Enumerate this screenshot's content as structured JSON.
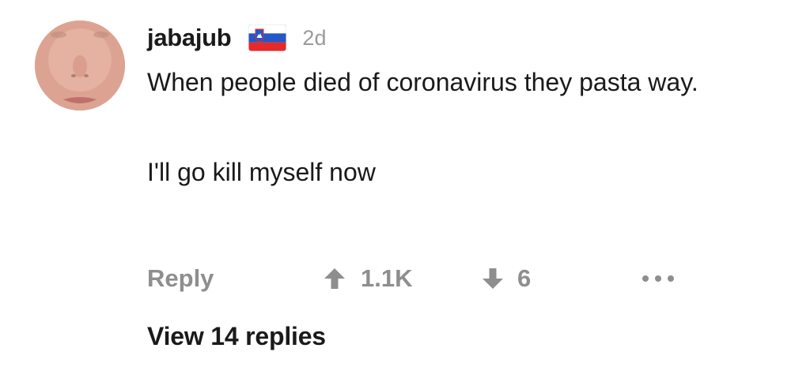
{
  "comment": {
    "author": "jabajub",
    "flag_icon": "slovenia-flag-icon",
    "age": "2d",
    "text_paragraph_1": "When people died of coronavirus they pasta way.",
    "text_paragraph_2": "I'll go kill myself now",
    "actions": {
      "reply_label": "Reply",
      "upvote_icon": "arrow-up-icon",
      "upvote_count": "1.1K",
      "downvote_icon": "arrow-down-icon",
      "downvote_count": "6",
      "more_icon": "more-options-icon"
    },
    "view_replies_label": "View 14 replies"
  },
  "colors": {
    "primary_text": "#1a1a1a",
    "muted_text": "#8e8e8e",
    "timestamp": "#9a9a9a",
    "background": "#ffffff"
  }
}
